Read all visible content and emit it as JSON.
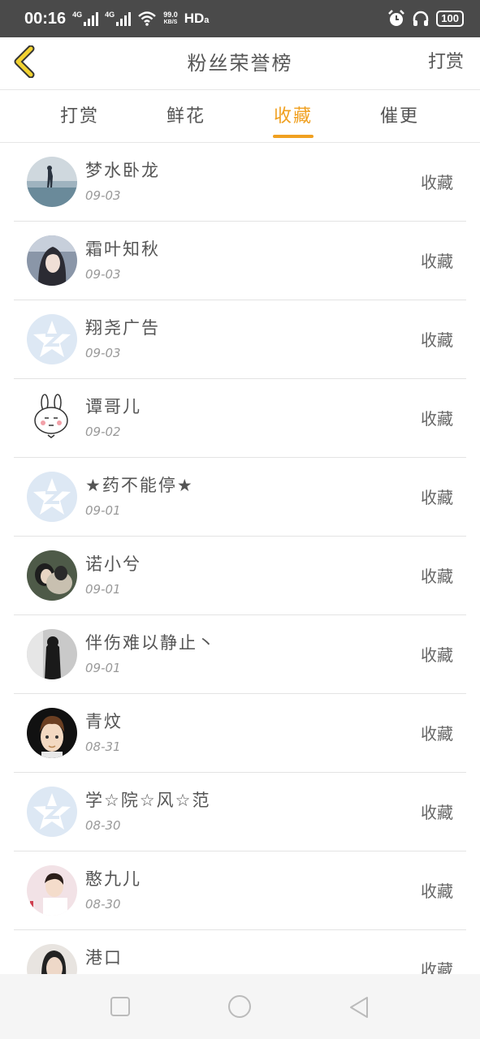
{
  "status_bar": {
    "time": "00:16",
    "net1": "4G",
    "net2": "4G",
    "speed_top": "99.0",
    "speed_bottom": "KB/S",
    "hd": "HD",
    "battery": "100"
  },
  "header": {
    "title": "粉丝荣誉榜",
    "action": "打赏"
  },
  "tabs": [
    {
      "label": "打赏"
    },
    {
      "label": "鲜花"
    },
    {
      "label": "收藏"
    },
    {
      "label": "催更"
    }
  ],
  "active_tab": "收藏",
  "colors": {
    "accent": "#f0a020",
    "back_icon": "#e8c020",
    "status_bar": "#4a4a4a"
  },
  "rows": [
    {
      "name": "梦水卧龙",
      "date": "09-03",
      "action": "收藏",
      "avatar": "photo-beach"
    },
    {
      "name": "霜叶知秋",
      "date": "09-03",
      "action": "收藏",
      "avatar": "photo-girl"
    },
    {
      "name": "翔尧广告",
      "date": "09-03",
      "action": "收藏",
      "avatar": "qq-default"
    },
    {
      "name": "谭哥儿",
      "date": "09-02",
      "action": "收藏",
      "avatar": "cartoon-rabbit"
    },
    {
      "name": "★药不能停★",
      "date": "09-01",
      "action": "收藏",
      "avatar": "qq-default"
    },
    {
      "name": "诺小兮",
      "date": "09-01",
      "action": "收藏",
      "avatar": "photo-couple"
    },
    {
      "name": "伴伤难以静止丶",
      "date": "09-01",
      "action": "收藏",
      "avatar": "photo-bw"
    },
    {
      "name": "青炆",
      "date": "08-31",
      "action": "收藏",
      "avatar": "cartoon-boy"
    },
    {
      "name": "学☆院☆风☆范",
      "date": "08-30",
      "action": "收藏",
      "avatar": "qq-default"
    },
    {
      "name": "憨九儿",
      "date": "08-30",
      "action": "收藏",
      "avatar": "photo-red"
    },
    {
      "name": "港口",
      "date": "",
      "action": "收藏",
      "avatar": "photo-man"
    }
  ],
  "navbar": {
    "icons": [
      "recent-apps-icon",
      "home-icon",
      "back-icon"
    ]
  }
}
